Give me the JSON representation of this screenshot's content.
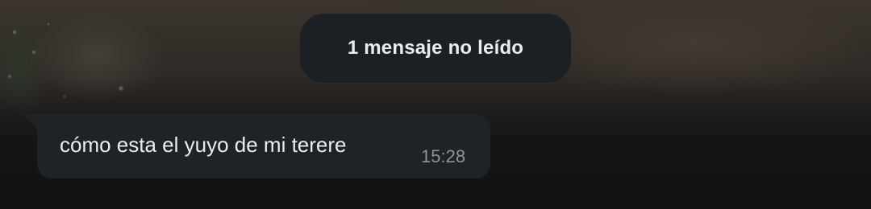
{
  "unread_banner": {
    "label": "1 mensaje no leído"
  },
  "messages": [
    {
      "text": "cómo esta el yuyo de mi terere",
      "time": "15:28",
      "direction": "incoming"
    }
  ],
  "colors": {
    "bubble_background": "#202326",
    "pill_background": "#1c2024",
    "primary_text": "#e9edef",
    "timestamp_text": "#8c9499"
  }
}
